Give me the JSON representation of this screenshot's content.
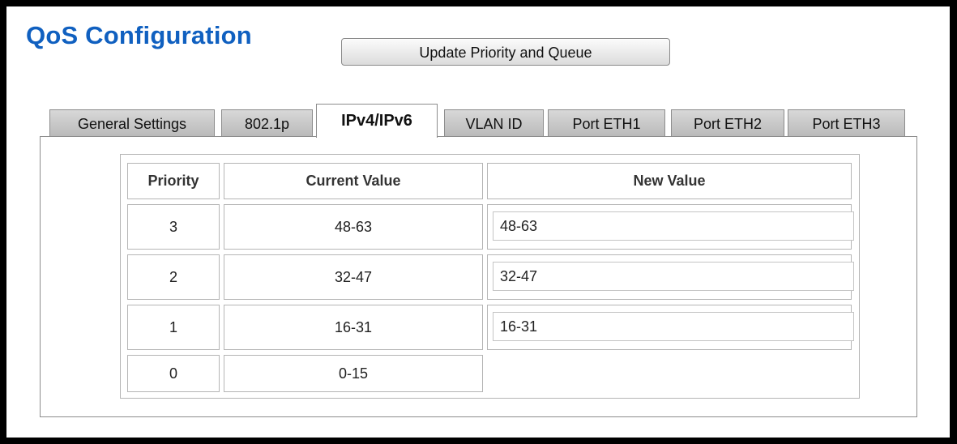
{
  "page": {
    "title": "QoS Configuration",
    "update_button": "Update Priority and Queue"
  },
  "tabs": [
    {
      "label": "General Settings",
      "active": false
    },
    {
      "label": "802.1p",
      "active": false
    },
    {
      "label": "IPv4/IPv6",
      "active": true
    },
    {
      "label": "VLAN ID",
      "active": false
    },
    {
      "label": "Port ETH1",
      "active": false
    },
    {
      "label": "Port ETH2",
      "active": false
    },
    {
      "label": "Port ETH3",
      "active": false
    }
  ],
  "table": {
    "headers": [
      "Priority",
      "Current Value",
      "New Value"
    ],
    "rows": [
      {
        "priority": "3",
        "current": "48-63",
        "new_value": "48-63"
      },
      {
        "priority": "2",
        "current": "32-47",
        "new_value": "32-47"
      },
      {
        "priority": "1",
        "current": "16-31",
        "new_value": "16-31"
      },
      {
        "priority": "0",
        "current": "0-15"
      }
    ]
  },
  "colors": {
    "title": "#1060c0",
    "background": "#000000",
    "tab_inactive": "#c8c8c8",
    "border": "#b5b5b5"
  }
}
